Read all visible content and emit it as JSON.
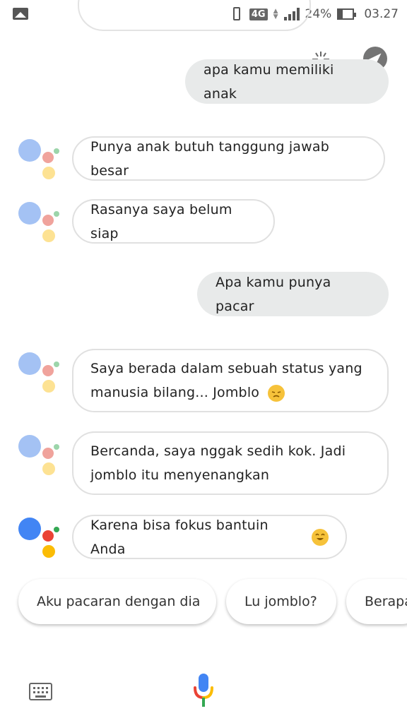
{
  "status_bar": {
    "network": "4G",
    "battery": "24%",
    "time": "03.27"
  },
  "messages": [
    {
      "role": "user",
      "text": "apa kamu memiliki anak"
    },
    {
      "role": "assistant",
      "text": "Punya anak butuh tanggung jawab besar"
    },
    {
      "role": "assistant",
      "text": "Rasanya saya belum siap"
    },
    {
      "role": "user",
      "text": "Apa kamu punya pacar"
    },
    {
      "role": "assistant",
      "line1": "Saya berada dalam sebuah status yang",
      "line2": "manusia bilang... Jomblo",
      "emoji": "worried-face"
    },
    {
      "role": "assistant",
      "line1": "Bercanda, saya nggak sedih kok. Jadi",
      "line2": "jomblo itu menyenangkan"
    },
    {
      "role": "assistant",
      "text": "Karena bisa fokus bantuin Anda",
      "emoji": "hugging-face"
    }
  ],
  "suggestions": [
    "Aku pacaran dengan dia",
    "Lu jomblo?",
    "Berapa"
  ],
  "colors": {
    "google_blue": "#4285f4",
    "google_red": "#ea4335",
    "google_yellow": "#fbbc05",
    "google_green": "#34a853",
    "user_bubble": "#e8eaea"
  }
}
